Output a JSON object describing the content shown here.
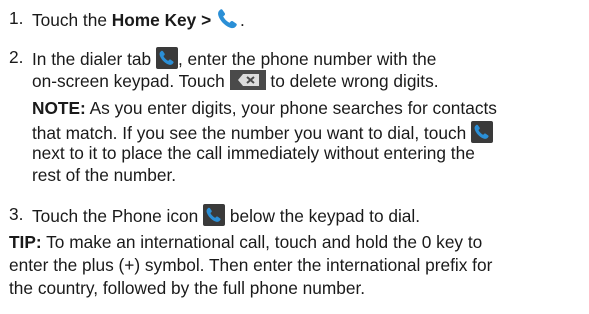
{
  "steps": [
    {
      "number": "1.",
      "text_pre": "Touch the ",
      "bold": "Home Key >",
      "text_post": "."
    },
    {
      "number": "2.",
      "line1_pre": "In the dialer tab",
      "line1_post": ", enter the phone number with the",
      "line2_pre": "on-screen keypad. Touch",
      "line2_post": "to delete wrong digits."
    },
    {
      "number": "3.",
      "text_pre": "Touch the Phone icon",
      "text_post": "below the keypad to dial."
    }
  ],
  "note": {
    "label": "NOTE:",
    "line1": "As you enter digits, your phone searches for contacts",
    "line2": "that match. If you see the number you want to dial, touch",
    "line3": "next to it to place the call immediately without entering the",
    "line4": "rest of the number."
  },
  "tip": {
    "label": "TIP:",
    "line1": "To make an international call, touch and hold the 0 key to",
    "line2": "enter the plus (+) symbol. Then enter the international prefix for",
    "line3": "the country, followed by the full phone number."
  },
  "icons": {
    "phone_plain": "phone-icon",
    "phone_box": "phone-tab-icon",
    "backspace": "backspace-icon"
  },
  "colors": {
    "phone_blue": "#2b8fd6",
    "icon_box": "#3a3a3a",
    "text": "#1a1a1a"
  }
}
